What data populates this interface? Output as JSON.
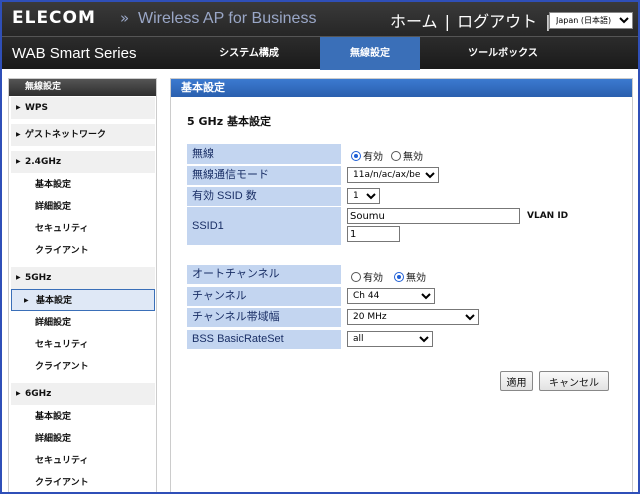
{
  "header": {
    "brand": "ELECOM",
    "separator": "»",
    "product": "Wireless AP for Business",
    "home_link": "ホーム",
    "divider": "|",
    "logout_link": "ログアウト",
    "divider2": "|",
    "language": "Japan (日本語)"
  },
  "nav": {
    "series": "WAB Smart Series",
    "tabs": [
      {
        "label": "システム構成"
      },
      {
        "label": "無線設定"
      },
      {
        "label": "ツールボックス"
      }
    ],
    "active_color": "#3a6fb8"
  },
  "sidebar": {
    "heading": "無線設定",
    "groups": [
      {
        "label": "WPS"
      },
      {
        "label": "ゲストネットワーク"
      },
      {
        "label": "2.4GHz"
      },
      {
        "label": "5GHz"
      },
      {
        "label": "6GHz"
      }
    ],
    "items_24": [
      {
        "label": "基本設定"
      },
      {
        "label": "詳細設定"
      },
      {
        "label": "セキュリティ"
      },
      {
        "label": "クライアント"
      }
    ],
    "items_5": [
      {
        "label": "基本設定"
      },
      {
        "label": "詳細設定"
      },
      {
        "label": "セキュリティ"
      },
      {
        "label": "クライアント"
      }
    ],
    "items_6": [
      {
        "label": "基本設定"
      },
      {
        "label": "詳細設定"
      },
      {
        "label": "セキュリティ"
      },
      {
        "label": "クライアント"
      }
    ]
  },
  "main": {
    "heading": "基本設定",
    "section_title": "5 GHz 基本設定",
    "wireless": {
      "label": "無線",
      "on": "有効",
      "off": "無効",
      "selected": "on"
    },
    "mode": {
      "label": "無線通信モード",
      "value": "11a/n/ac/ax/be"
    },
    "ssid_count": {
      "label": "有効 SSID 数",
      "value": "1"
    },
    "ssid1": {
      "label": "SSID1",
      "value": "Soumu",
      "vlan_label": "VLAN ID",
      "vlan_value": "1"
    },
    "auto_channel": {
      "label": "オートチャンネル",
      "on": "有効",
      "off": "無効",
      "selected": "off"
    },
    "channel": {
      "label": "チャンネル",
      "value": "Ch 44"
    },
    "bandwidth": {
      "label": "チャンネル帯域幅",
      "value": "20 MHz"
    },
    "basic_rate": {
      "label": "BSS BasicRateSet",
      "value": "all"
    },
    "apply_button": "適用",
    "cancel_button": "キャンセル"
  }
}
